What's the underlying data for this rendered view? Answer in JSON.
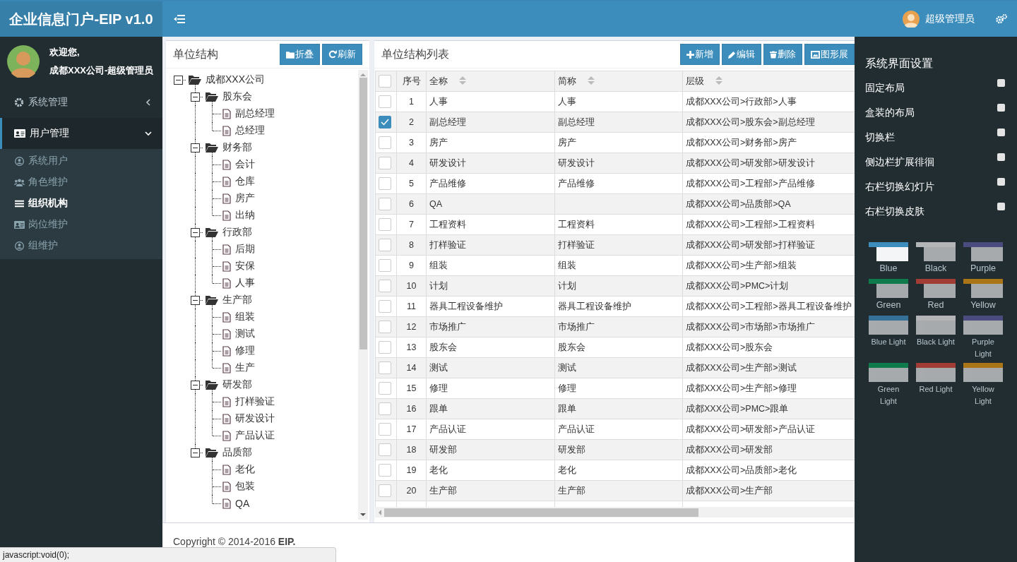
{
  "header": {
    "logo": "企业信息门户-EIP v1.0",
    "user": "超级管理员"
  },
  "user_panel": {
    "greeting": "欢迎您,",
    "name": "成都XXX公司-超级管理员"
  },
  "sidebar": {
    "items": [
      {
        "label": "系统管理",
        "expanded": false,
        "selected": false
      },
      {
        "label": "用户管理",
        "expanded": true,
        "selected": true,
        "children": [
          {
            "label": "系统用户",
            "selected": false
          },
          {
            "label": "角色维护",
            "selected": false
          },
          {
            "label": "组织机构",
            "selected": true
          },
          {
            "label": "岗位维护",
            "selected": false
          },
          {
            "label": "组维护",
            "selected": false
          }
        ]
      }
    ]
  },
  "tree_panel": {
    "title": "单位结构",
    "buttons": [
      "折叠",
      "刷新"
    ],
    "tree": [
      {
        "label": "成都XXX公司",
        "expanded": true,
        "children": [
          {
            "label": "股东会",
            "expanded": true,
            "children": [
              {
                "label": "副总经理"
              },
              {
                "label": "总经理"
              }
            ]
          },
          {
            "label": "财务部",
            "expanded": true,
            "children": [
              {
                "label": "会计"
              },
              {
                "label": "仓库"
              },
              {
                "label": "房产"
              },
              {
                "label": "出纳"
              }
            ]
          },
          {
            "label": "行政部",
            "expanded": true,
            "children": [
              {
                "label": "后期"
              },
              {
                "label": "安保"
              },
              {
                "label": "人事"
              }
            ]
          },
          {
            "label": "生产部",
            "expanded": true,
            "children": [
              {
                "label": "组装"
              },
              {
                "label": "测试"
              },
              {
                "label": "修理"
              },
              {
                "label": "生产"
              }
            ]
          },
          {
            "label": "研发部",
            "expanded": true,
            "children": [
              {
                "label": "打样验证"
              },
              {
                "label": "研发设计"
              },
              {
                "label": "产品认证"
              }
            ]
          },
          {
            "label": "品质部",
            "expanded": true,
            "children": [
              {
                "label": "老化"
              },
              {
                "label": "包装"
              },
              {
                "label": "QA"
              }
            ]
          }
        ]
      }
    ]
  },
  "table_panel": {
    "title": "单位结构列表",
    "buttons": [
      "新增",
      "编辑",
      "删除",
      "图形展"
    ],
    "all_selected": false,
    "columns": [
      {
        "label": "序号",
        "sortable": false
      },
      {
        "label": "全称",
        "sortable": true
      },
      {
        "label": "简称",
        "sortable": true
      },
      {
        "label": "层级",
        "sortable": true
      }
    ],
    "rows": [
      {
        "selected": false,
        "cells": [
          "1",
          "人事",
          "人事",
          "成都XXX公司>行政部>人事"
        ]
      },
      {
        "selected": true,
        "cells": [
          "2",
          "副总经理",
          "副总经理",
          "成都XXX公司>股东会>副总经理"
        ]
      },
      {
        "selected": false,
        "cells": [
          "3",
          "房产",
          "房产",
          "成都XXX公司>财务部>房产"
        ]
      },
      {
        "selected": false,
        "cells": [
          "4",
          "研发设计",
          "研发设计",
          "成都XXX公司>研发部>研发设计"
        ]
      },
      {
        "selected": false,
        "cells": [
          "5",
          "产品维修",
          "产品维修",
          "成都XXX公司>工程部>产品维修"
        ]
      },
      {
        "selected": false,
        "cells": [
          "6",
          "QA",
          "",
          "成都XXX公司>品质部>QA"
        ]
      },
      {
        "selected": false,
        "cells": [
          "7",
          "工程资料",
          "工程资料",
          "成都XXX公司>工程部>工程资料"
        ]
      },
      {
        "selected": false,
        "cells": [
          "8",
          "打样验证",
          "打样验证",
          "成都XXX公司>研发部>打样验证"
        ]
      },
      {
        "selected": false,
        "cells": [
          "9",
          "组装",
          "组装",
          "成都XXX公司>生产部>组装"
        ]
      },
      {
        "selected": false,
        "cells": [
          "10",
          "计划",
          "计划",
          "成都XXX公司>PMC>计划"
        ]
      },
      {
        "selected": false,
        "cells": [
          "11",
          "器具工程设备维护",
          "器具工程设备维护",
          "成都XXX公司>工程部>器具工程设备维护"
        ]
      },
      {
        "selected": false,
        "cells": [
          "12",
          "市场推广",
          "市场推广",
          "成都XXX公司>市场部>市场推广"
        ]
      },
      {
        "selected": false,
        "cells": [
          "13",
          "股东会",
          "股东会",
          "成都XXX公司>股东会"
        ]
      },
      {
        "selected": false,
        "cells": [
          "14",
          "测试",
          "测试",
          "成都XXX公司>生产部>测试"
        ]
      },
      {
        "selected": false,
        "cells": [
          "15",
          "修理",
          "修理",
          "成都XXX公司>生产部>修理"
        ]
      },
      {
        "selected": false,
        "cells": [
          "16",
          "跟单",
          "跟单",
          "成都XXX公司>PMC>跟单"
        ]
      },
      {
        "selected": false,
        "cells": [
          "17",
          "产品认证",
          "产品认证",
          "成都XXX公司>研发部>产品认证"
        ]
      },
      {
        "selected": false,
        "cells": [
          "18",
          "研发部",
          "研发部",
          "成都XXX公司>研发部"
        ]
      },
      {
        "selected": false,
        "cells": [
          "19",
          "老化",
          "老化",
          "成都XXX公司>品质部>老化"
        ]
      },
      {
        "selected": false,
        "cells": [
          "20",
          "生产部",
          "生产部",
          "成都XXX公司>生产部"
        ]
      }
    ]
  },
  "footer": {
    "copyright": "Copyright © 2014-2016 **EIP.**"
  },
  "status_bar": "javascript:void(0);",
  "settings": {
    "title": "系统界面设置",
    "options": [
      {
        "label": "固定布局",
        "checked": false
      },
      {
        "label": "盒装的布局",
        "checked": false
      },
      {
        "label": "切换栏",
        "checked": false
      },
      {
        "label": "侧边栏扩展徘徊",
        "checked": false
      },
      {
        "label": "右栏切换幻灯片",
        "checked": false
      },
      {
        "label": "右栏切换皮肤",
        "checked": false
      }
    ],
    "skins": [
      {
        "name": "Blue",
        "color": "#3c8dbc",
        "light": false,
        "selected": true
      },
      {
        "name": "Black",
        "color": "#b3b5b7",
        "light": false,
        "selected": false
      },
      {
        "name": "Purple",
        "color": "#4a4c80",
        "light": false,
        "selected": false
      },
      {
        "name": "Green",
        "color": "#0f7a4c",
        "light": false,
        "selected": false
      },
      {
        "name": "Red",
        "color": "#a13d34",
        "light": false,
        "selected": false
      },
      {
        "name": "Yellow",
        "color": "#a97516",
        "light": false,
        "selected": false
      },
      {
        "name": "Blue Light",
        "color": "#357099",
        "light": true,
        "selected": false
      },
      {
        "name": "Black Light",
        "color": "#b3b5b7",
        "light": true,
        "selected": false
      },
      {
        "name": "Purple Light",
        "color": "#4a4c80",
        "light": true,
        "selected": false
      },
      {
        "name": "Green Light",
        "color": "#0f7a4c",
        "light": true,
        "selected": false
      },
      {
        "name": "Red Light",
        "color": "#a13d34",
        "light": true,
        "selected": false
      },
      {
        "name": "Yellow Light",
        "color": "#a97516",
        "light": true,
        "selected": false
      }
    ]
  }
}
